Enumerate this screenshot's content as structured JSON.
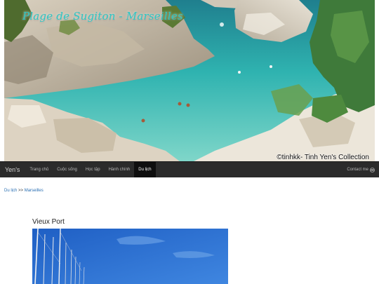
{
  "header": {
    "title": "Plage de Sugiton - Marseilles",
    "credit": "©tinhkk- Tinh Yen's Collection"
  },
  "navbar": {
    "brand": "Yen's",
    "items": [
      {
        "label": "Trang chủ",
        "active": false
      },
      {
        "label": "Cuộc sống",
        "active": false
      },
      {
        "label": "Học tập",
        "active": false
      },
      {
        "label": "Hành chính",
        "active": false
      },
      {
        "label": "Du lịch",
        "active": true
      }
    ],
    "contact_label": "Contact me"
  },
  "breadcrumb": {
    "parent": "Du lịch",
    "separator": ">>",
    "current": "Marseilles"
  },
  "post": {
    "title": "Vieux Port"
  },
  "colors": {
    "navbar_bg": "#2b2b2b",
    "link": "#2a6fb3",
    "title_accent": "#2ec7c4"
  }
}
